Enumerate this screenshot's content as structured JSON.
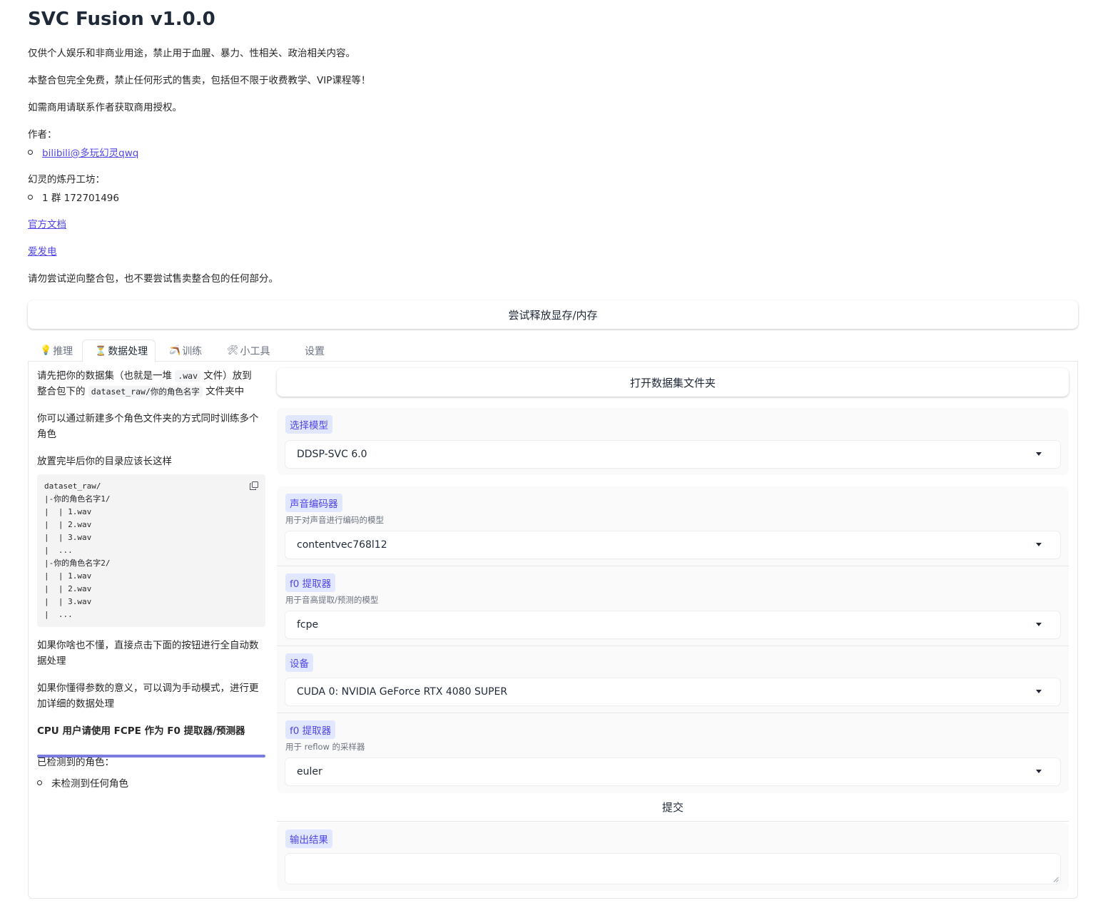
{
  "app": {
    "title": "SVC Fusion v1.0.0"
  },
  "intro": {
    "line1": "仅供个人娱乐和非商业用途，禁止用于血腥、暴力、性相关、政治相关内容。",
    "line2": "本整合包完全免费，禁止任何形式的售卖，包括但不限于收费教学、VIP课程等！",
    "line3": "如需商用请联系作者获取商用授权。",
    "author_label": "作者：",
    "author_link": "bilibili@多玩幻灵qwq",
    "workshop_label": "幻灵的炼丹工坊：",
    "workshop_group": "1 群 172701496",
    "docs_link": "官方文档",
    "afdian_link": "爱发电",
    "warning": "请勿尝试逆向整合包，也不要尝试售卖整合包的任何部分。"
  },
  "free_memory_button": "尝试释放显存/内存",
  "tabs": [
    {
      "icon": "lightbulb-icon",
      "glyph": "💡",
      "label": "推理"
    },
    {
      "icon": "hourglass-icon",
      "glyph": "⏳",
      "label": "数据处理"
    },
    {
      "icon": "slingshot-icon",
      "glyph": "🪃",
      "label": "训练"
    },
    {
      "icon": "tools-icon",
      "glyph": "🛠",
      "label": "小工具"
    },
    {
      "icon": "",
      "glyph": "",
      "label": "设置"
    }
  ],
  "active_tab": 1,
  "left": {
    "p1_a": "请先把你的数据集（也就是一堆 ",
    "p1_code1": ".wav",
    "p1_b": " 文件）放到",
    "p1_c": "整合包下的 ",
    "p1_code2": "dataset_raw/你的角色名字",
    "p1_d": " 文件夹中",
    "p2": "你可以通过新建多个角色文件夹的方式同时训练多个角色",
    "p3": "放置完毕后你的目录应该长这样",
    "code": "dataset_raw/\n|-你的角色名字1/\n|  | 1.wav\n|  | 2.wav\n|  | 3.wav\n|  ...\n|-你的角色名字2/\n|  | 1.wav\n|  | 2.wav\n|  | 3.wav\n|  ...",
    "p4": "如果你啥也不懂，直接点击下面的按钮进行全自动数据处理",
    "p5": "如果你懂得参数的意义，可以调为手动模式，进行更加详细的数据处理",
    "p6": "CPU 用户请使用 FCPE 作为 F0 提取器/预测器",
    "detected_label": "已检测到的角色：",
    "detected_item": "未检测到任何角色"
  },
  "right": {
    "open_dataset_button": "打开数据集文件夹",
    "model": {
      "label": "选择模型",
      "value": "DDSP-SVC 6.0"
    },
    "encoder": {
      "label": "声音编码器",
      "info": "用于对声音进行编码的模型",
      "value": "contentvec768l12"
    },
    "f0": {
      "label": "f0 提取器",
      "info": "用于音高提取/预测的模型",
      "value": "fcpe"
    },
    "device": {
      "label": "设备",
      "value": "CUDA 0: NVIDIA GeForce RTX 4080 SUPER"
    },
    "sampler": {
      "label": "f0 提取器",
      "info": "用于 reflow 的采样器",
      "value": "euler"
    },
    "submit_button": "提交",
    "output": {
      "label": "输出结果",
      "value": ""
    }
  },
  "colors": {
    "accent": "#4f46e5",
    "chip_bg": "#e0e7ff",
    "progress": "#7c7ce0"
  }
}
